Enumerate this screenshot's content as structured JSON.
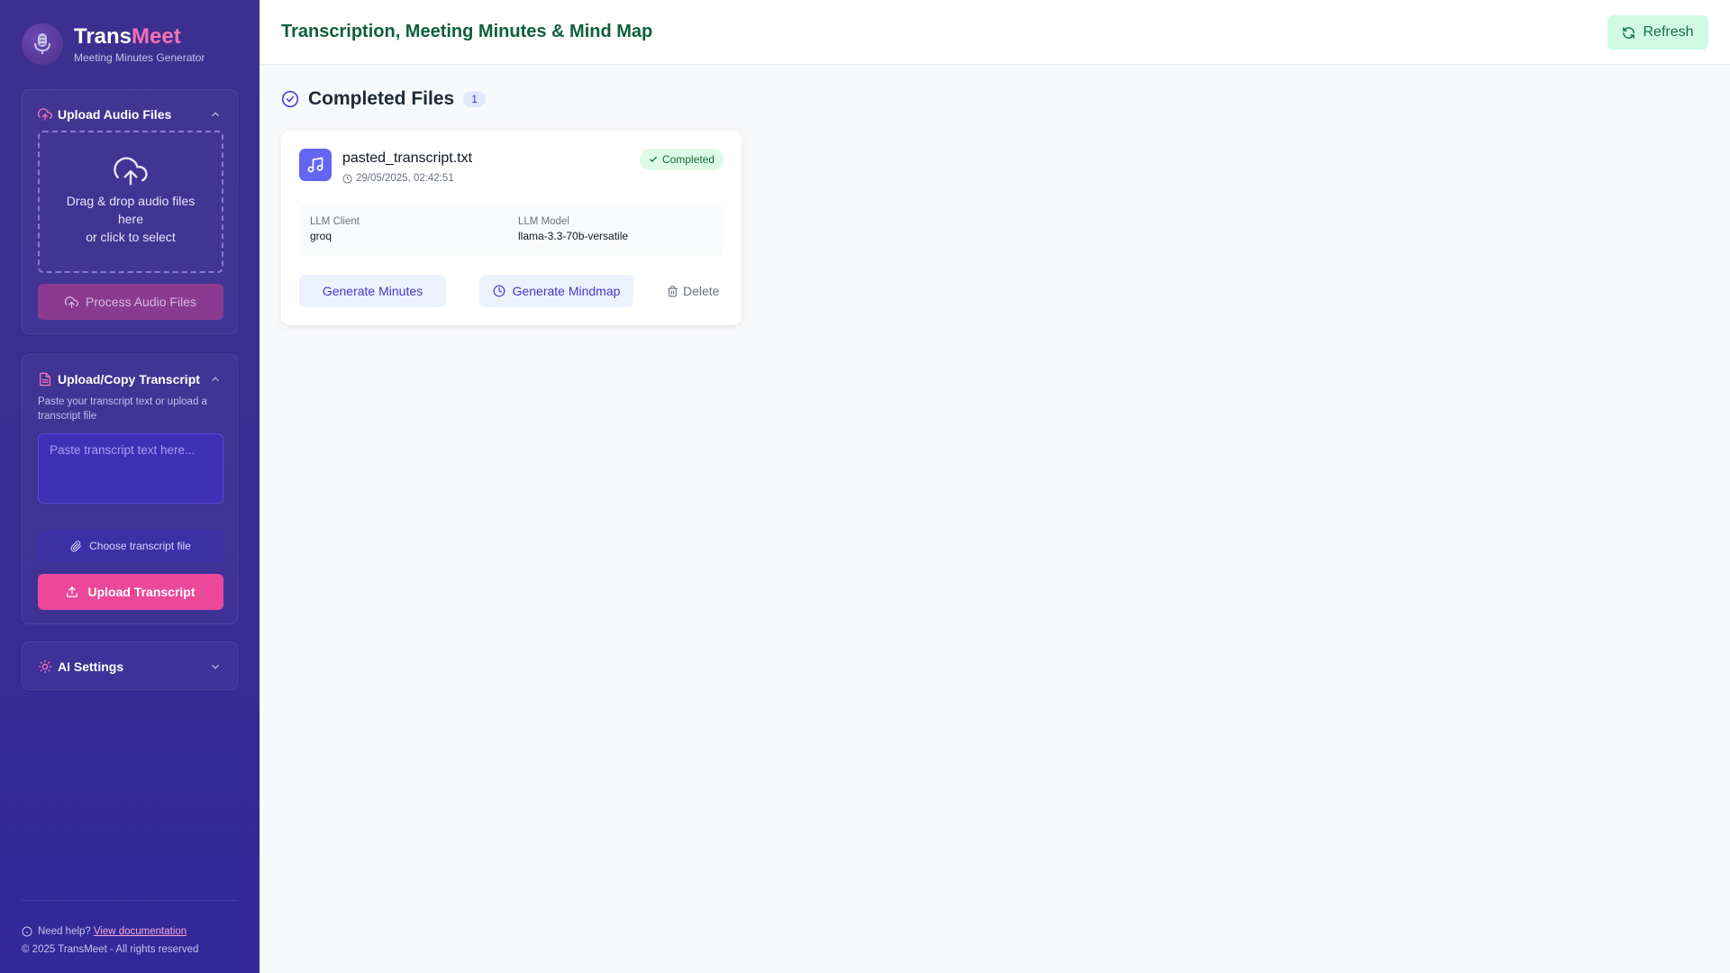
{
  "brand": {
    "title_part1": "Trans",
    "title_part2": "Meet",
    "subtitle": "Meeting Minutes Generator"
  },
  "sidebar": {
    "upload_audio": {
      "title": "Upload Audio Files",
      "drop_line1": "Drag & drop audio files here",
      "drop_line2": "or click to select",
      "process_button": "Process Audio Files"
    },
    "transcript": {
      "title": "Upload/Copy Transcript",
      "description": "Paste your transcript text or upload a transcript file",
      "placeholder": "Paste transcript text here...",
      "choose_button": "Choose transcript file",
      "upload_button": "Upload Transcript"
    },
    "ai_settings": {
      "title": "AI Settings"
    },
    "footer": {
      "help_text": "Need help?",
      "help_link": "View documentation",
      "copyright": "© 2025 TransMeet - All rights reserved"
    }
  },
  "header": {
    "title": "Transcription, Meeting Minutes & Mind Map",
    "refresh_button": "Refresh"
  },
  "completed": {
    "title": "Completed Files",
    "count": "1",
    "files": [
      {
        "name": "pasted_transcript.txt",
        "date": "29/05/2025, 02:42:51",
        "status": "Completed",
        "llm_client_label": "LLM Client",
        "llm_client": "groq",
        "llm_model_label": "LLM Model",
        "llm_model": "llama-3.3-70b-versatile",
        "generate_minutes": "Generate Minutes",
        "generate_mindmap": "Generate Mindmap",
        "delete": "Delete"
      }
    ]
  },
  "colors": {
    "sidebar": "#3a2d92",
    "accent_pink": "#ec4899",
    "accent_indigo": "#6366f1",
    "title_green": "#0f5f3e",
    "success_bg": "#dcfce7"
  }
}
